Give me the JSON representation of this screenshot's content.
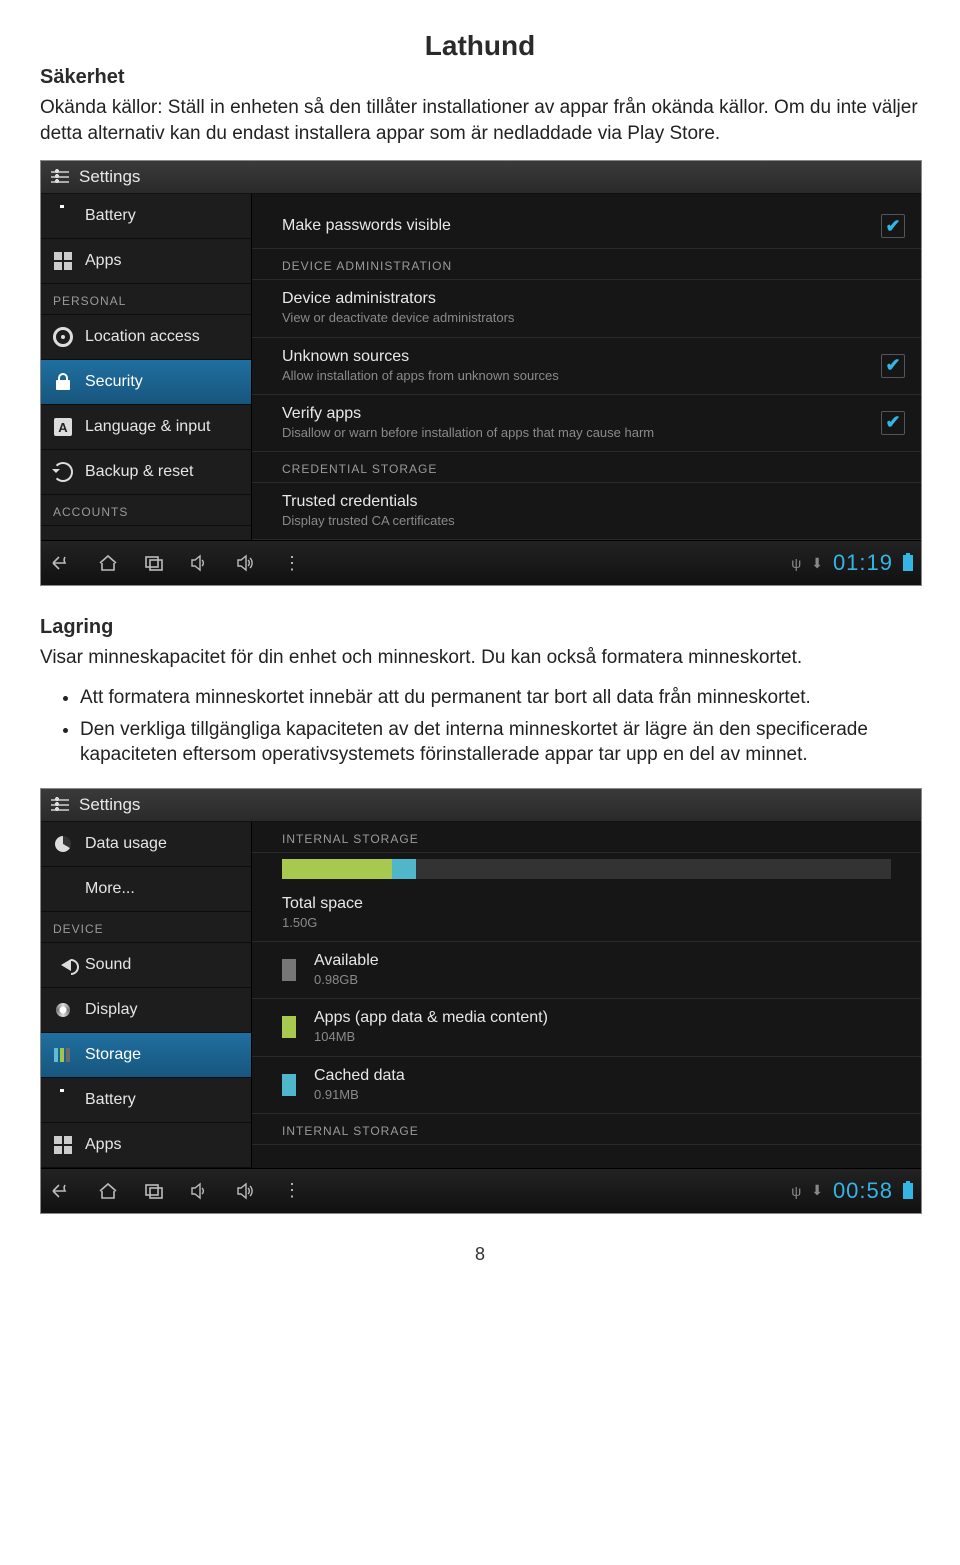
{
  "doc": {
    "title": "Lathund",
    "page_number": "8"
  },
  "security_section": {
    "heading": "Säkerhet",
    "paragraph": "Okända källor: Ställ in enheten så den tillåter installationer av appar från okända källor. Om du inte väljer detta alternativ kan du endast installera appar som är nedladdade via Play Store."
  },
  "storage_section": {
    "heading": "Lagring",
    "paragraph": "Visar minneskapacitet för din enhet och minneskort. Du kan också formatera minneskortet.",
    "bullets": [
      "Att formatera minneskortet innebär att du permanent tar bort all data från minneskortet.",
      "Den verkliga tillgängliga kapaciteten av det interna minneskortet är lägre än den specificerade kapaciteten eftersom operativsystemets förinstallerade appar tar upp en del av minnet."
    ]
  },
  "shot1": {
    "header_title": "Settings",
    "sidebar": {
      "items": [
        {
          "label": "Battery",
          "icon": "battery"
        },
        {
          "label": "Apps",
          "icon": "apps"
        }
      ],
      "cat_personal": "PERSONAL",
      "personal_items": [
        {
          "label": "Location access",
          "icon": "location"
        },
        {
          "label": "Security",
          "icon": "lock",
          "active": true
        },
        {
          "label": "Language & input",
          "icon": "lang",
          "letter": "A"
        },
        {
          "label": "Backup & reset",
          "icon": "reset"
        }
      ],
      "cat_accounts": "ACCOUNTS"
    },
    "content": {
      "rows_top": [
        {
          "title": "Make passwords visible",
          "checked": true
        }
      ],
      "cat_admin": "DEVICE ADMINISTRATION",
      "rows_admin": [
        {
          "title": "Device administrators",
          "sub": "View or deactivate device administrators"
        },
        {
          "title": "Unknown sources",
          "sub": "Allow installation of apps from unknown sources",
          "checked": true
        },
        {
          "title": "Verify apps",
          "sub": "Disallow or warn before installation of apps that may cause harm",
          "checked": true
        }
      ],
      "cat_cred": "CREDENTIAL STORAGE",
      "rows_cred": [
        {
          "title": "Trusted credentials",
          "sub": "Display trusted CA certificates"
        }
      ]
    },
    "clock": "01:19"
  },
  "shot2": {
    "header_title": "Settings",
    "sidebar": {
      "items": [
        {
          "label": "Data usage",
          "icon": "pie"
        },
        {
          "label": "More...",
          "icon": "none"
        }
      ],
      "cat_device": "DEVICE",
      "device_items": [
        {
          "label": "Sound",
          "icon": "sound"
        },
        {
          "label": "Display",
          "icon": "display"
        },
        {
          "label": "Storage",
          "icon": "storage",
          "active": true
        },
        {
          "label": "Battery",
          "icon": "battery"
        },
        {
          "label": "Apps",
          "icon": "apps"
        }
      ]
    },
    "content": {
      "cat_internal": "INTERNAL STORAGE",
      "bar_segments": [
        {
          "color": "#a7c94f",
          "pct": 18
        },
        {
          "color": "#4fb7c9",
          "pct": 4
        }
      ],
      "rows": [
        {
          "title": "Total space",
          "sub": "1.50G"
        },
        {
          "chip": "gray",
          "title": "Available",
          "sub": "0.98GB"
        },
        {
          "chip": "green",
          "title": "Apps (app data & media content)",
          "sub": "104MB"
        },
        {
          "chip": "teal",
          "title": "Cached data",
          "sub": "0.91MB"
        }
      ],
      "cat_internal2": "INTERNAL STORAGE"
    },
    "clock": "00:58"
  },
  "nav": {
    "back": "↶",
    "home": "⬠",
    "recent": "▭",
    "vol_down": "🔉",
    "vol_up": "🔊",
    "menu": "⋮",
    "usb": "ψ",
    "dl": "⬇"
  }
}
